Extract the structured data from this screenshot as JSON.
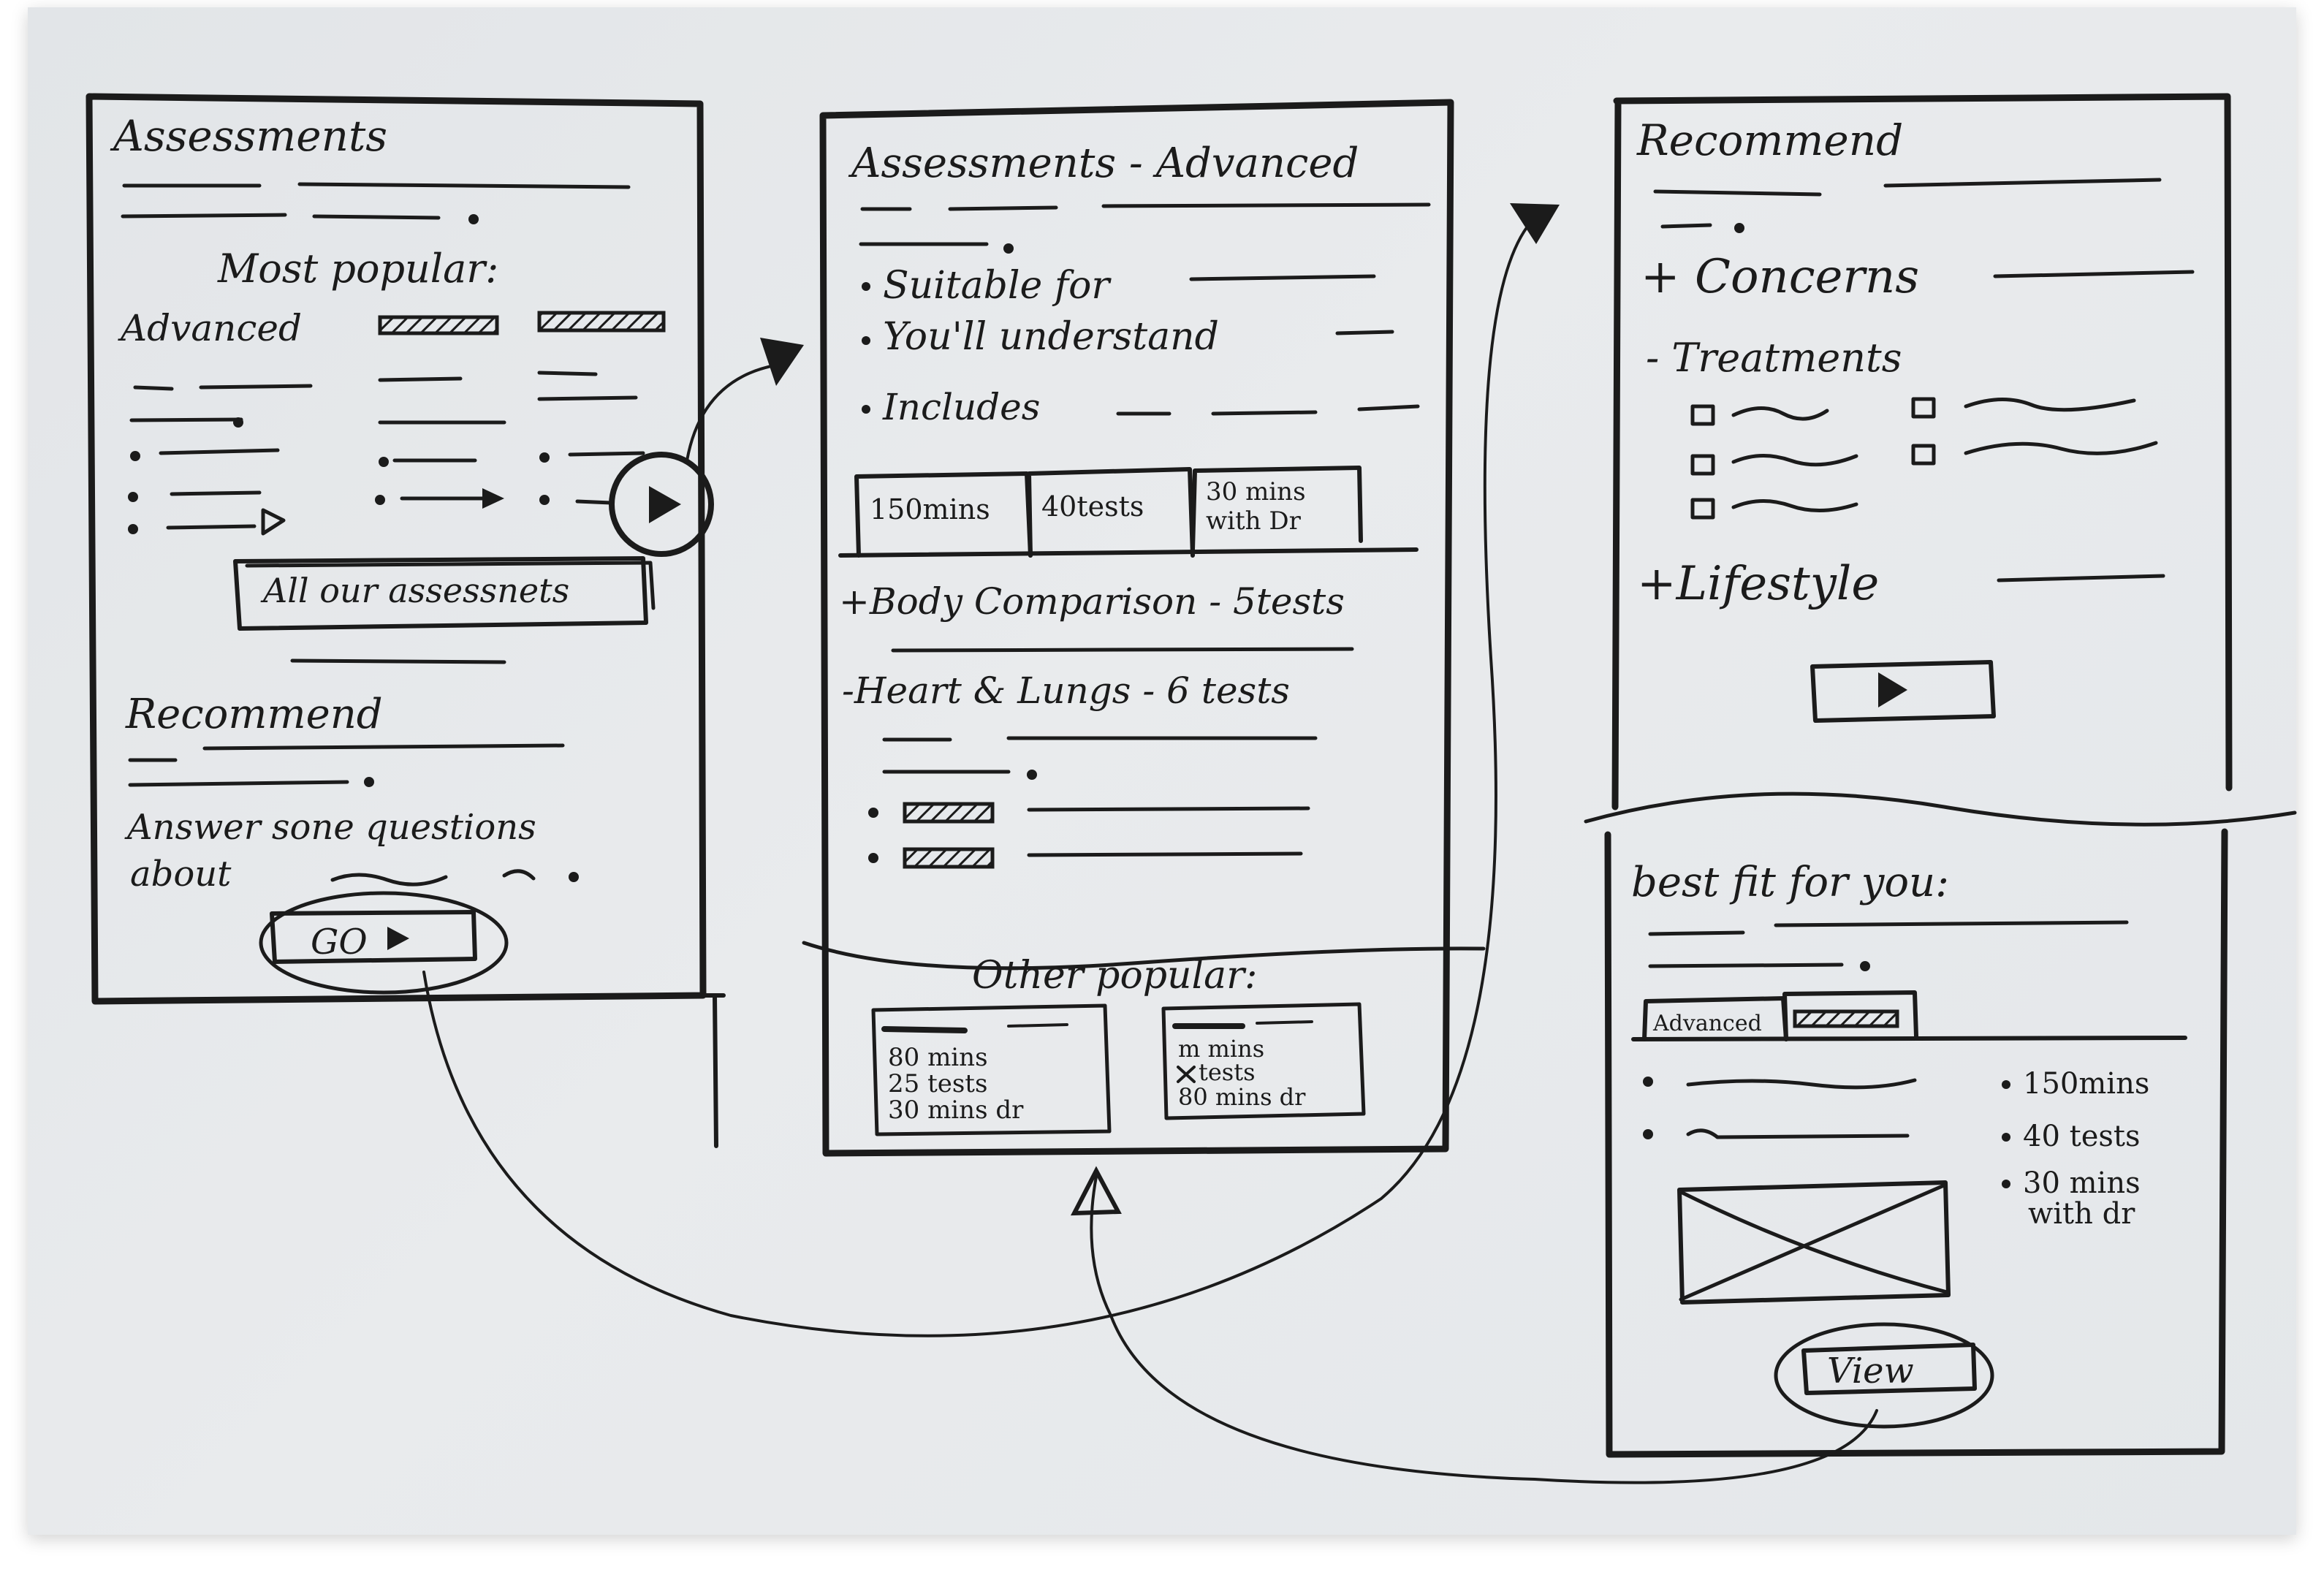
{
  "screen1": {
    "title": "Assessments",
    "most_popular_label": "Most popular:",
    "card_label": "Advanced",
    "all_button_label": "All our assessnets",
    "recommend_heading": "Recommend",
    "answer_line1": "Answer sone questions",
    "answer_line2": "about",
    "go_button_label": "GO"
  },
  "screen2": {
    "title": "Assessments - Advanced",
    "bullets": [
      "Suitable for",
      "You'll understand",
      "Includes"
    ],
    "tabs": [
      "150mins",
      "40tests",
      "30 mins",
      "with Dr"
    ],
    "section1": "+Body Comparison - 5tests",
    "section2": "-Heart & Lungs - 6 tests",
    "other_popular_label": "Other popular:",
    "other_card1": [
      "80 mins",
      "25 tests",
      "30 mins dr"
    ],
    "other_card2": [
      "m mins",
      "tests",
      "80 mins dr"
    ]
  },
  "screen3": {
    "title": "Recommend",
    "concerns_label": "+ Concerns",
    "treatments_label": "- Treatments",
    "lifestyle_label": "+Lifestyle"
  },
  "screen4": {
    "title": "best fit for you:",
    "tab_label": "Advanced",
    "stats": [
      "150mins",
      "40 tests",
      "30 mins",
      "with dr"
    ],
    "view_button_label": "View"
  },
  "icons": [
    "play-icon",
    "play-circle-icon",
    "arrowhead-icon",
    "image-placeholder-icon",
    "checkbox-icon"
  ],
  "colors": {
    "ink": "#1b1b1b",
    "paper": "#e6e9ec"
  }
}
